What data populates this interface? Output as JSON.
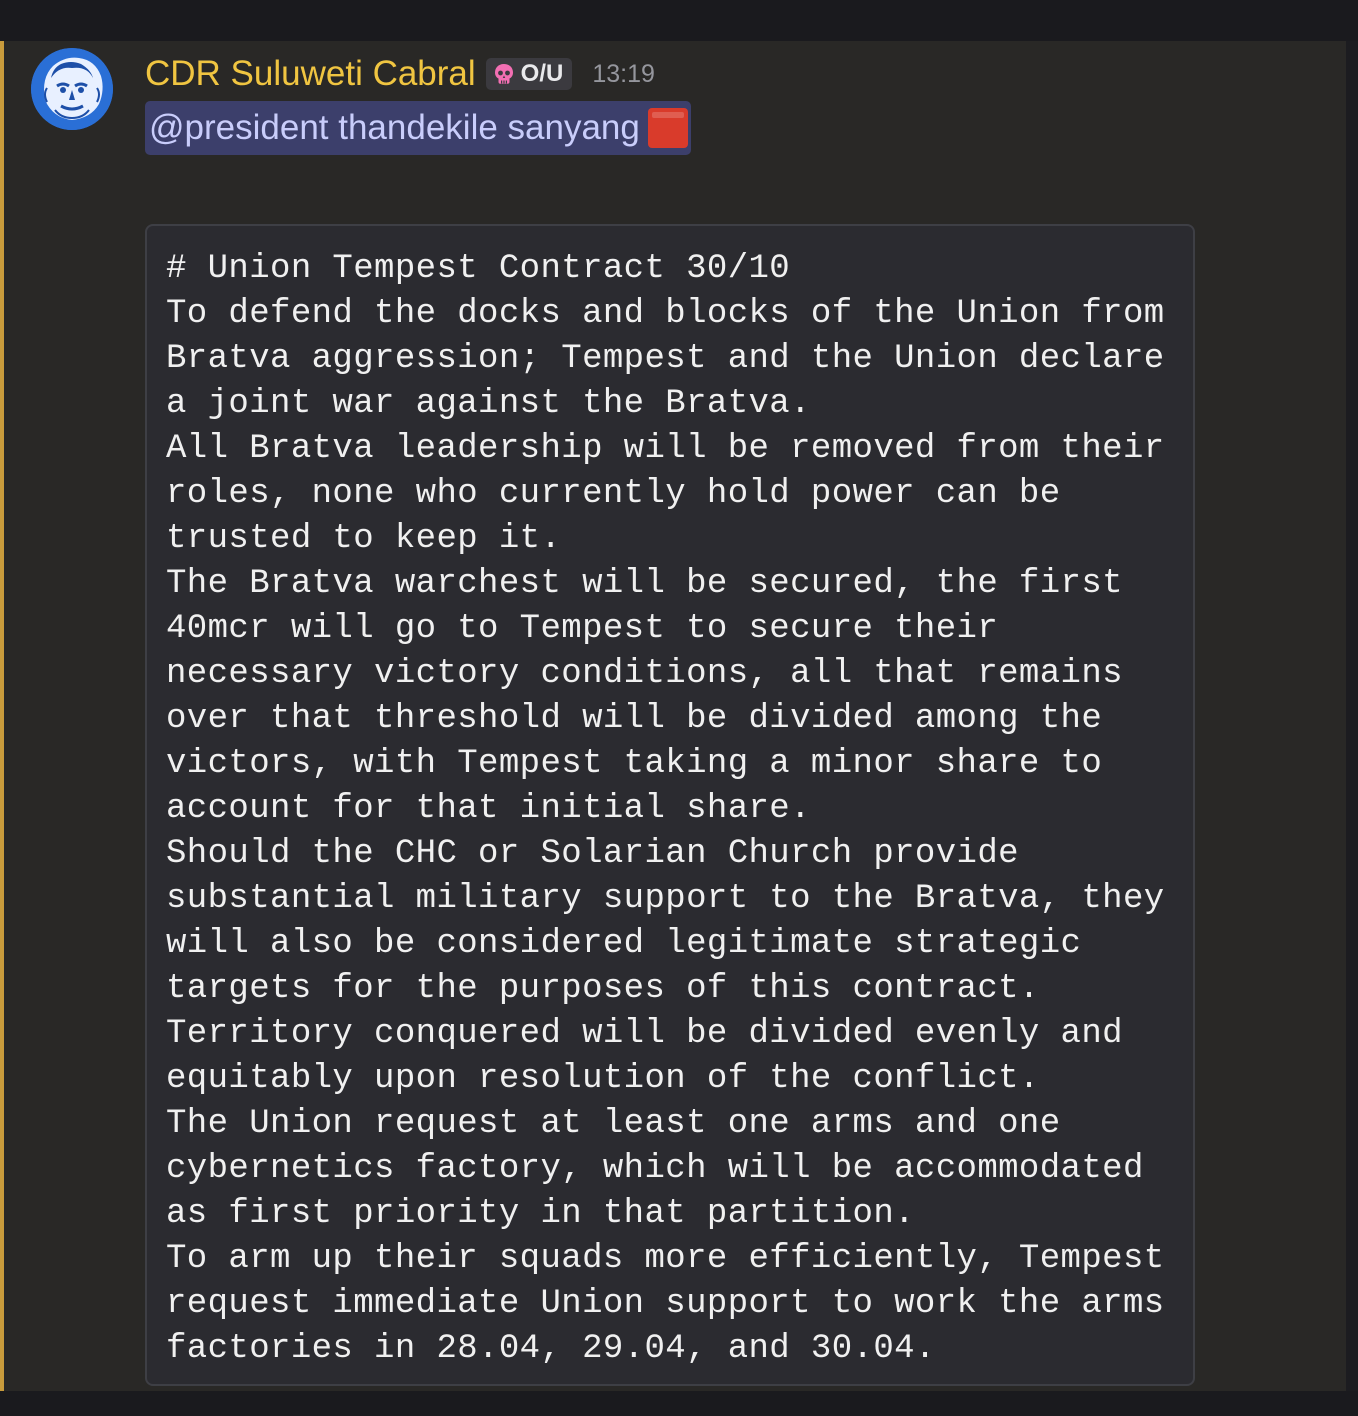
{
  "message": {
    "author": "CDR Suluweti Cabral",
    "role_tag": "O/U",
    "role_icon": "pink-skull-icon",
    "timestamp": "13:19",
    "mention": "@president thandekile sanyang",
    "emoji": "red-square-icon",
    "code_lines": [
      "# Union Tempest Contract 30/10",
      "To defend the docks and blocks of the Union from",
      "Bratva aggression; Tempest and the Union declare",
      "a joint war against the Bratva.",
      "All Bratva leadership will be removed from their",
      "roles, none who currently hold power can be",
      "trusted to keep it.",
      "The Bratva warchest will be secured, the first",
      "40mcr will go to Tempest to secure their",
      "necessary victory conditions, all that remains",
      "over that threshold will be divided among the",
      "victors, with Tempest taking a minor share to",
      "account for that initial share.",
      "Should the CHC or Solarian Church provide",
      "substantial military support to the Bratva, they",
      "will also be considered legitimate strategic",
      "targets for the purposes of this contract.",
      "Territory conquered will be divided evenly and",
      "equitably upon resolution of the conflict.",
      "The Union request at least one arms and one",
      "cybernetics factory, which will be accommodated",
      "as first priority in that partition.",
      "To arm up their squads more efficiently, Tempest",
      "request immediate Union support to work the arms",
      "factories in 28.04, 29.04, and 30.04."
    ]
  },
  "colors": {
    "accent_bar": "#c89b3c",
    "username": "#f0c541",
    "mention_bg": "#3c3f6b",
    "mention_text": "#c9cdfb",
    "avatar_bg": "#2a6fd6"
  }
}
